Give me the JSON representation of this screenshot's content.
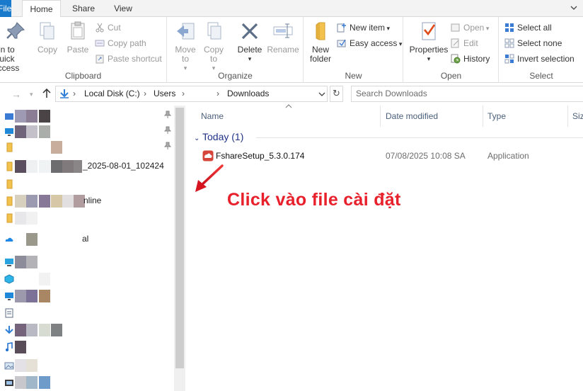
{
  "tabs": {
    "file": "File",
    "home": "Home",
    "share": "Share",
    "view": "View"
  },
  "ribbon": {
    "clipboard": {
      "label": "Clipboard",
      "pin": "Pin to Quick access",
      "copy": "Copy",
      "paste": "Paste",
      "cut": "Cut",
      "copy_path": "Copy path",
      "paste_shortcut": "Paste shortcut"
    },
    "organize": {
      "label": "Organize",
      "move_to": "Move to",
      "copy_to": "Copy to",
      "delete": "Delete",
      "rename": "Rename"
    },
    "new": {
      "label": "New",
      "new_folder": "New folder",
      "new_item": "New item",
      "easy_access": "Easy access"
    },
    "open": {
      "label": "Open",
      "properties": "Properties",
      "open": "Open",
      "edit": "Edit",
      "history": "History"
    },
    "select": {
      "label": "Select",
      "select_all": "Select all",
      "select_none": "Select none",
      "invert_selection": "Invert selection"
    }
  },
  "address": {
    "crumbs": [
      "Local Disk (C:)",
      "Users",
      "Downloads"
    ],
    "search_placeholder": "Search Downloads"
  },
  "nav": {
    "items": [
      {
        "label": "",
        "icon": "quick-access-icon",
        "pinned": true
      },
      {
        "label": "",
        "icon": "desktop-icon",
        "pinned": true
      },
      {
        "label": "",
        "icon": "folder-icon",
        "pinned": true
      },
      {
        "label": "_2025-08-01_102424",
        "icon": "folder-icon",
        "pinned": false
      },
      {
        "label": "",
        "icon": "folder-icon",
        "pinned": false
      },
      {
        "label": "nline",
        "icon": "folder-icon",
        "pinned": false
      },
      {
        "label": "",
        "icon": "folder-icon",
        "pinned": false
      },
      {
        "label": "al",
        "icon": "onedrive-icon",
        "pinned": false
      },
      {
        "label": "",
        "icon": "this-pc-icon",
        "pinned": false
      },
      {
        "label": "",
        "icon": "3d-objects-icon",
        "pinned": false
      },
      {
        "label": "",
        "icon": "desktop-icon",
        "pinned": false
      },
      {
        "label": "",
        "icon": "documents-icon",
        "pinned": false
      },
      {
        "label": "",
        "icon": "downloads-icon",
        "pinned": false
      },
      {
        "label": "",
        "icon": "music-icon",
        "pinned": false
      },
      {
        "label": "",
        "icon": "pictures-icon",
        "pinned": false
      },
      {
        "label": "",
        "icon": "videos-icon",
        "pinned": false
      }
    ]
  },
  "content": {
    "columns": [
      "Name",
      "Date modified",
      "Type",
      "Siz"
    ],
    "group": "Today (1)",
    "files": [
      {
        "name": "FshareSetup_5.3.0.174",
        "date": "07/08/2025 10:08 SA",
        "type": "Application",
        "icon": "fshare-app-icon"
      }
    ]
  },
  "annotation": {
    "text": "Click vào file cài đặt",
    "color": "#e8202c"
  },
  "colors": {
    "file_tab": "#1979ca",
    "folder": "#f2c14e",
    "accent": "#1e3287"
  }
}
